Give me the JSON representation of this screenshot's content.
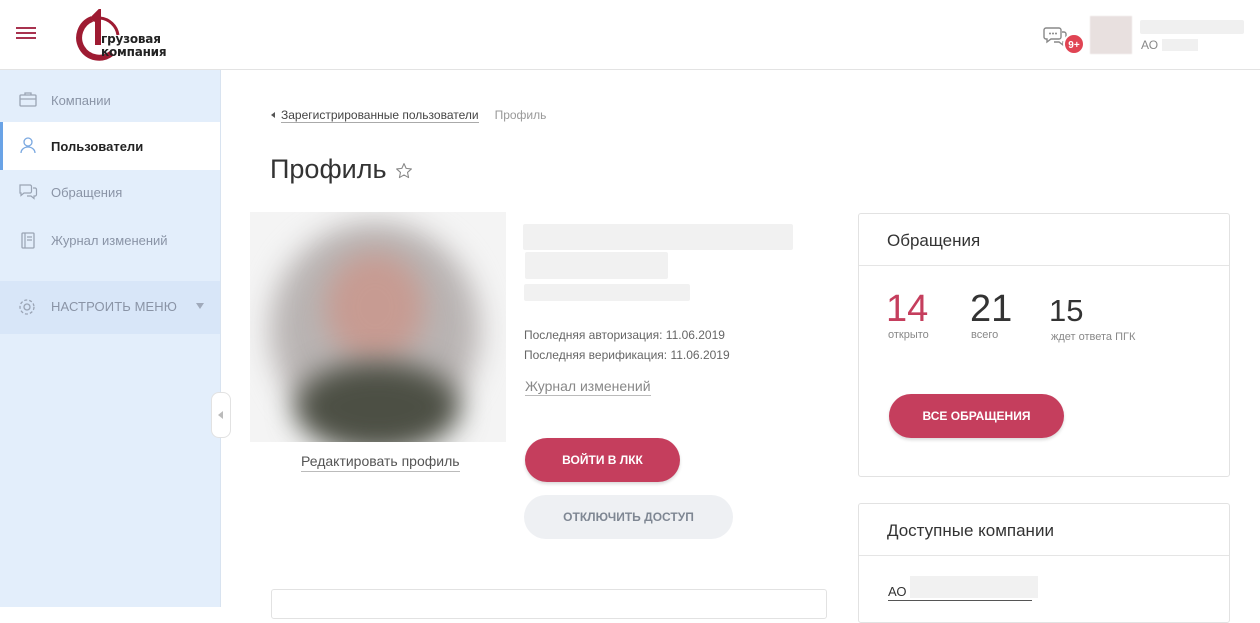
{
  "header": {
    "logo_text_line1": "грузовая",
    "logo_text_line2": "компания",
    "notifications_badge": "9+",
    "user_org_prefix": "АО"
  },
  "sidebar": {
    "items": [
      {
        "label": "Компании",
        "icon": "briefcase-icon",
        "active": false
      },
      {
        "label": "Пользователи",
        "icon": "user-icon",
        "active": true
      },
      {
        "label": "Обращения",
        "icon": "chat-icon",
        "active": false
      },
      {
        "label": "Журнал изменений",
        "icon": "journal-icon",
        "active": false
      }
    ],
    "settings_label": "НАСТРОИТЬ МЕНЮ"
  },
  "breadcrumb": {
    "parent": "Зарегистрированные пользователи",
    "current": "Профиль"
  },
  "page": {
    "title": "Профиль"
  },
  "profile": {
    "edit_label": "Редактировать профиль",
    "last_auth": "Последняя авторизация: 11.06.2019",
    "last_verify": "Последняя верификация: 11.06.2019",
    "journal_link": "Журнал изменений",
    "login_button": "ВОЙТИ В ЛКК",
    "disable_button": "ОТКЛЮЧИТЬ ДОСТУП"
  },
  "requests_card": {
    "title": "Обращения",
    "stats": [
      {
        "value": "14",
        "label": "открыто",
        "color": "#c53e5d"
      },
      {
        "value": "21",
        "label": "всего",
        "color": "#333333"
      },
      {
        "value": "15",
        "label": "ждет ответа ПГК",
        "color": "#333333"
      }
    ],
    "button": "ВСЕ ОБРАЩЕНИЯ"
  },
  "companies_card": {
    "title": "Доступные компании",
    "first_company_prefix": "АО"
  },
  "colors": {
    "accent": "#c53e5d",
    "sidebar_bg": "#e3eefb",
    "active_marker": "#6aa3e6"
  }
}
